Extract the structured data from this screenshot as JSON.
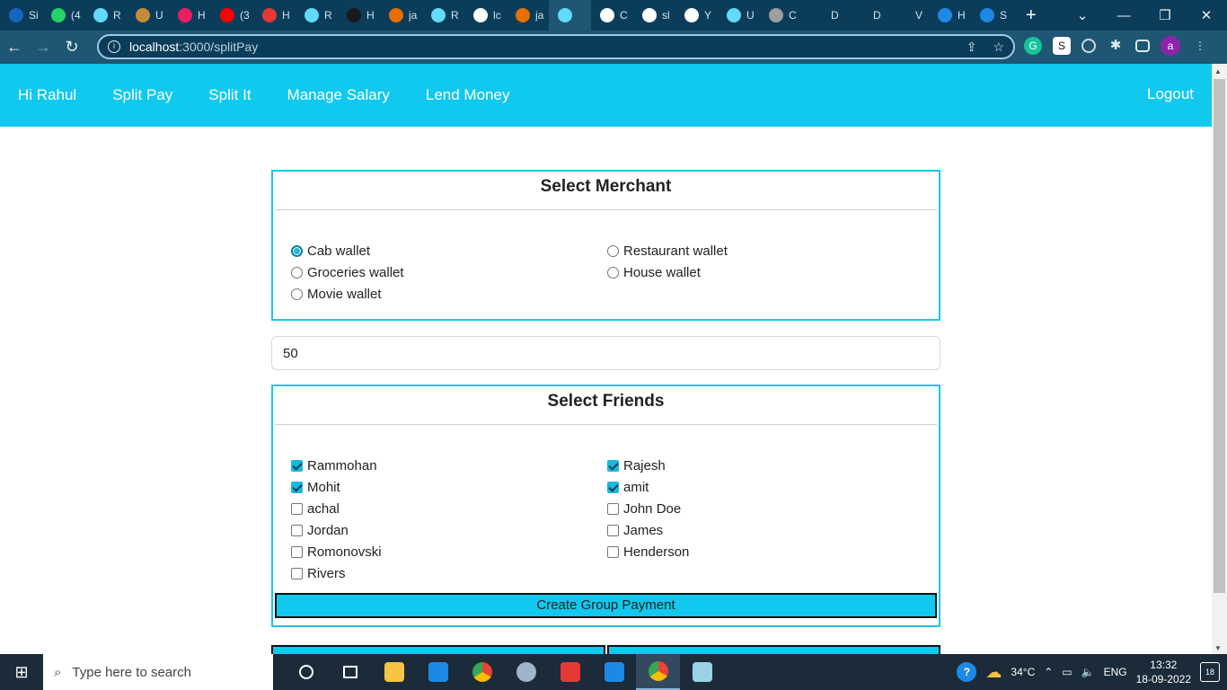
{
  "browser": {
    "tabs": [
      {
        "label": "Si",
        "color": "#1565c0"
      },
      {
        "label": "(4",
        "color": "#25d366"
      },
      {
        "label": "R",
        "color": "#61dafb"
      },
      {
        "label": "U",
        "color": "#c58b3b"
      },
      {
        "label": "H",
        "color": "#e91e63"
      },
      {
        "label": "(3",
        "color": "#ff0000"
      },
      {
        "label": "H",
        "color": "#e53935"
      },
      {
        "label": "R",
        "color": "#61dafb"
      },
      {
        "label": "H",
        "color": "#1a1a1a"
      },
      {
        "label": "ja",
        "color": "#e76f00"
      },
      {
        "label": "R",
        "color": "#61dafb"
      },
      {
        "label": "lc",
        "color": "#ffffff"
      },
      {
        "label": "ja",
        "color": "#e76f00"
      },
      {
        "label": "",
        "color": "#61dafb"
      },
      {
        "label": "C",
        "color": "#ffffff"
      },
      {
        "label": "sl",
        "color": "#ffffff"
      },
      {
        "label": "Y",
        "color": "#ffffff"
      },
      {
        "label": "U",
        "color": "#61dafb"
      },
      {
        "label": "C",
        "color": "#9e9e9e"
      },
      {
        "label": "D",
        "color": "#0b3d5b"
      },
      {
        "label": "D",
        "color": "#0b3d5b"
      },
      {
        "label": "V",
        "color": "#0b3d5b"
      },
      {
        "label": "H",
        "color": "#1e88e5"
      },
      {
        "label": "S",
        "color": "#1e88e5"
      }
    ],
    "url_host": "localhost",
    "url_path": ":3000/splitPay",
    "profile_initial": "a"
  },
  "nav": {
    "greeting": "Hi Rahul",
    "items": [
      "Split Pay",
      "Split It",
      "Manage Salary",
      "Lend Money"
    ],
    "logout": "Logout"
  },
  "merchant": {
    "title": "Select Merchant",
    "options": [
      {
        "label": "Cab wallet",
        "selected": true
      },
      {
        "label": "Restaurant wallet",
        "selected": false
      },
      {
        "label": "Groceries wallet",
        "selected": false
      },
      {
        "label": "House wallet",
        "selected": false
      },
      {
        "label": "Movie wallet",
        "selected": false
      }
    ]
  },
  "amount": {
    "value": "50"
  },
  "friends": {
    "title": "Select Friends",
    "options": [
      {
        "label": "Rammohan",
        "checked": true
      },
      {
        "label": "Rajesh",
        "checked": true
      },
      {
        "label": "Mohit",
        "checked": true
      },
      {
        "label": "amit",
        "checked": true
      },
      {
        "label": "achal",
        "checked": false
      },
      {
        "label": "John Doe",
        "checked": false
      },
      {
        "label": "Jordan",
        "checked": false
      },
      {
        "label": "James",
        "checked": false
      },
      {
        "label": "Romonovski",
        "checked": false
      },
      {
        "label": "Henderson",
        "checked": false
      },
      {
        "label": "Rivers",
        "checked": false
      }
    ],
    "submit": "Create Group Payment"
  },
  "taskbar": {
    "search_placeholder": "Type here to search",
    "weather": "34°C",
    "lang": "ENG",
    "time": "13:32",
    "date": "18-09-2022",
    "notifications": "18"
  }
}
